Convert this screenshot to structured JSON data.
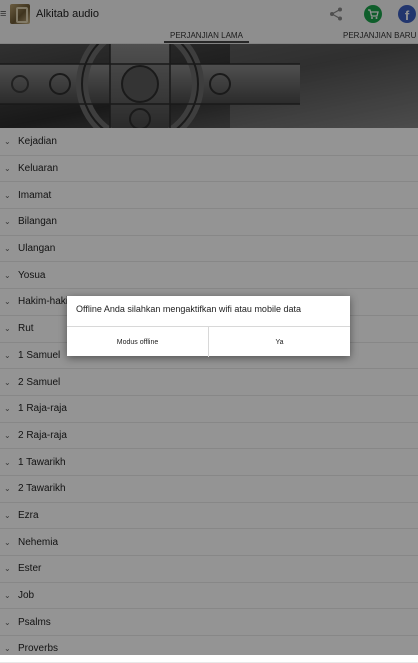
{
  "app": {
    "title": "Alkitab audio",
    "menu_glyph": "≡",
    "icons": [
      "menu-icon",
      "app-logo-icon",
      "share-icon",
      "cart-icon",
      "facebook-icon"
    ],
    "facebook_letter": "f",
    "colors": {
      "cart": "#1aa34a",
      "facebook": "#3b5dbe"
    }
  },
  "tabs": [
    {
      "label": "PERJANJIAN LAMA",
      "selected": true
    },
    {
      "label": "PERJANJIAN BARU",
      "selected": false
    }
  ],
  "books": [
    "Kejadian",
    "Keluaran",
    "Imamat",
    "Bilangan",
    "Ulangan",
    "Yosua",
    "Hakim-hakim",
    "Rut",
    "1 Samuel",
    "2 Samuel",
    "1 Raja-raja",
    "2 Raja-raja",
    "1 Tawarikh",
    "2 Tawarikh",
    "Ezra",
    "Nehemia",
    "Ester",
    "Job",
    "Psalms",
    "Proverbs"
  ],
  "dialog": {
    "message": "Offline Anda silahkan mengaktifkan wifi atau mobile data",
    "offline_button": "Modus offline",
    "yes_button": "Ya"
  }
}
